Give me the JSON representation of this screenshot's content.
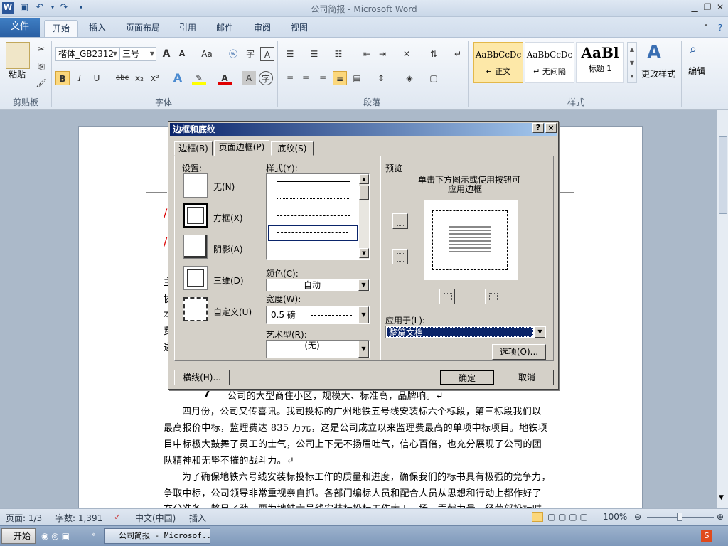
{
  "app": {
    "window_title": "公司简报 - Microsoft Word",
    "qat_icons": [
      "word-icon",
      "save-icon",
      "undo-icon",
      "redo-icon",
      "customize-icon"
    ]
  },
  "ribbon_tabs": [
    "文件",
    "开始",
    "插入",
    "页面布局",
    "引用",
    "邮件",
    "审阅",
    "视图"
  ],
  "ribbon": {
    "clipboard": {
      "paste": "粘贴",
      "label": "剪贴板"
    },
    "font": {
      "family": "楷体_GB2312",
      "size": "三号",
      "label": "字体",
      "grow": "A",
      "shrink": "A",
      "change_case": "Aa",
      "bold": "B",
      "italic": "I",
      "underline": "U",
      "strike": "abc",
      "sub": "x₂",
      "sup": "x²"
    },
    "paragraph": {
      "label": "段落"
    },
    "styles": {
      "label": "样式",
      "items": [
        {
          "preview": "AaBbCcDc",
          "name": "↵ 正文"
        },
        {
          "preview": "AaBbCcDc",
          "name": "↵ 无间隔"
        },
        {
          "preview": "AaBl",
          "name": "标题 1"
        }
      ],
      "change": "更改样式"
    },
    "editing": {
      "label": "编辑"
    }
  },
  "document": {
    "lines": [
      "公司的大型商住小区，规模大、标准高，品牌响。↵",
      "四月份，公司又传喜讯。我司投标的广州地铁五号线安装标六个标段，第三标段我们以",
      "最高报价中标，监理费达 835 万元，这是公司成立以来监理费最高的单项中标项目。地铁项",
      "目中标极大鼓舞了员工的士气，公司上下无不扬眉吐气，信心百倍，也充分展现了公司的团",
      "队精神和无坚不摧的战斗力。↵",
      "为了确保地铁六号线安装标投标工作的质量和进度，确保我们的标书具有极强的竞争力，",
      "争取中标，公司领导非常重视亲自抓。各部门编标人员和配合人员从思想和行动上都作好了",
      "充分准备，憋足了劲，要为地铁六号线安装标投标工作大干一场，贡献力量。经营部投标时，"
    ],
    "left_fragments": [
      "主",
      "协",
      "本",
      "费",
      "遂"
    ]
  },
  "dialog": {
    "title": "边框和底纹",
    "help": "?",
    "close": "×",
    "tabs": [
      "边框(B)",
      "页面边框(P)",
      "底纹(S)"
    ],
    "settings_label": "设置:",
    "settings": [
      "无(N)",
      "方框(X)",
      "阴影(A)",
      "三维(D)",
      "自定义(U)"
    ],
    "style_label": "样式(Y):",
    "color_label": "颜色(C):",
    "color_value": "自动",
    "width_label": "宽度(W):",
    "width_value": "0.5 磅",
    "art_label": "艺术型(R):",
    "art_value": "(无)",
    "preview_label": "预览",
    "preview_hint_1": "单击下方图示或使用按钮可",
    "preview_hint_2": "应用边框",
    "apply_label": "应用于(L):",
    "apply_value": "整篇文档",
    "options_button": "选项(O)...",
    "hline_button": "横线(H)...",
    "ok_button": "确定",
    "cancel_button": "取消"
  },
  "status": {
    "page": "页面: 1/3",
    "words": "字数: 1,391",
    "lang": "中文(中国)",
    "mode": "插入",
    "zoom": "100%"
  },
  "taskbar": {
    "start": "开始",
    "task": "公司简报 - Microsof..."
  }
}
